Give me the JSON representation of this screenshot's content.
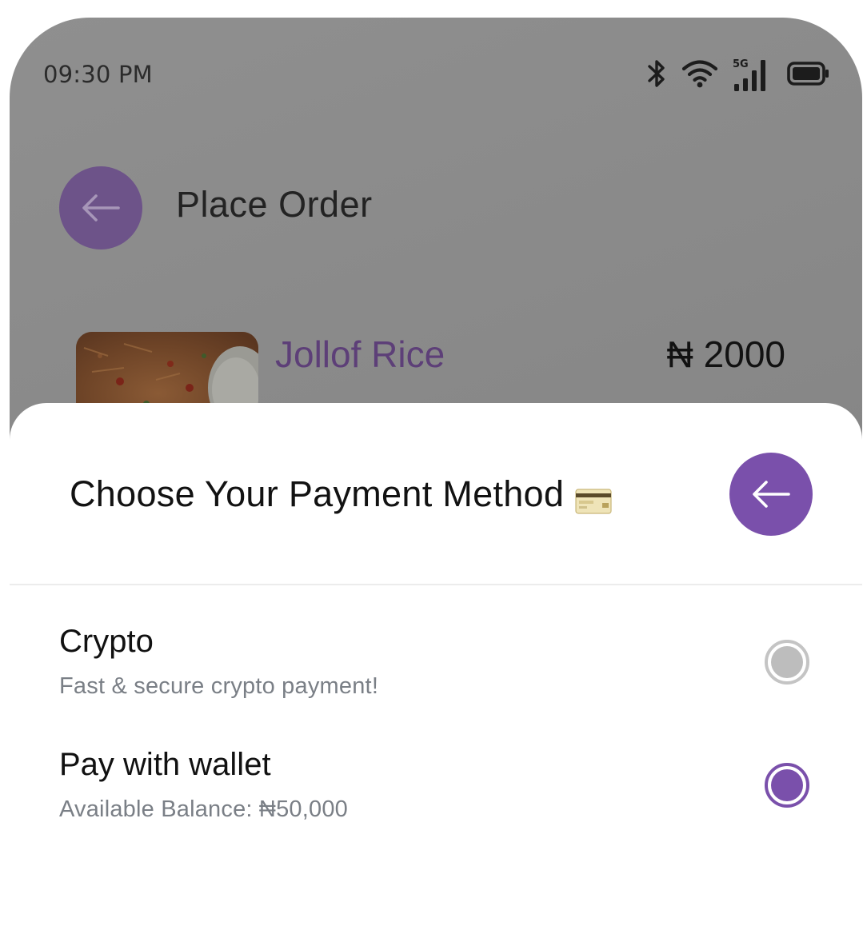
{
  "status_bar": {
    "time": "09:30 PM",
    "network_label": "5G",
    "icons": [
      "bluetooth-icon",
      "wifi-icon",
      "cellular-signal-icon",
      "battery-icon"
    ]
  },
  "header": {
    "title": "Place Order",
    "back_icon": "arrow-left-icon"
  },
  "order_item": {
    "name": "Jollof Rice",
    "price": "₦ 2000"
  },
  "payment_sheet": {
    "title": "Choose Your Payment Method",
    "title_icon": "credit-card-icon",
    "close_icon": "arrow-left-icon",
    "options": [
      {
        "label": "Crypto",
        "description": "Fast & secure crypto payment!",
        "selected": false
      },
      {
        "label": "Pay with wallet",
        "description": "Available Balance: ₦50,000",
        "selected": true
      }
    ]
  },
  "colors": {
    "accent": "#7a50ab",
    "accent_dimmed": "#6d5389",
    "item_name": "#5d3f78",
    "overlay": "#8a8a8a",
    "subtext": "#7a7f86"
  }
}
